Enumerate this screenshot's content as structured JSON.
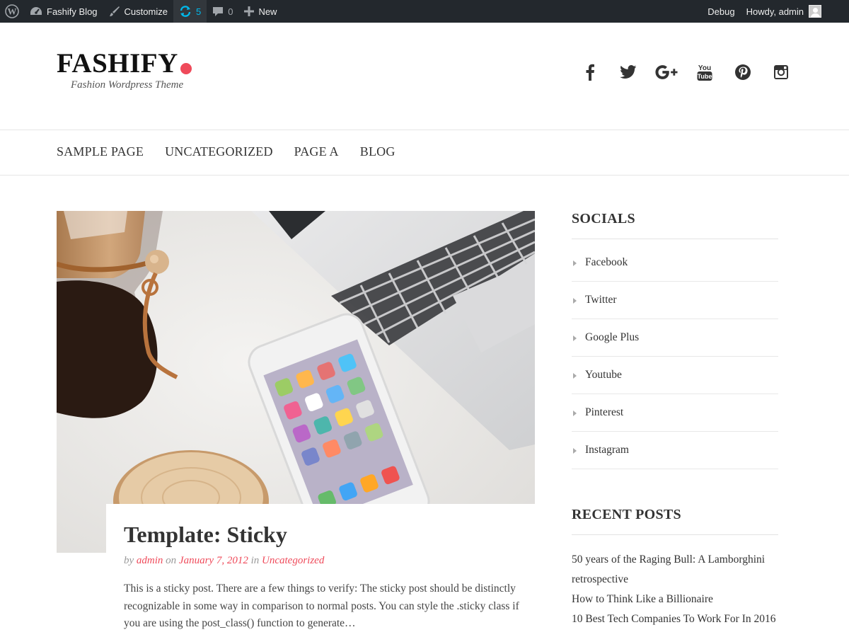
{
  "adminbar": {
    "wp_logo_icon": "wordpress-icon",
    "site_name": "Fashify Blog",
    "customize_label": "Customize",
    "updates_count": "5",
    "comments_count": "0",
    "new_label": "New",
    "debug_label": "Debug",
    "howdy_label": "Howdy, admin",
    "colors": {
      "background": "#23282d",
      "updates_accent": "#00b9eb"
    }
  },
  "header": {
    "site_title": "FASHIFY",
    "tagline": "Fashion Wordpress Theme",
    "accent_color": "#ef4a5a",
    "social_icons": [
      "facebook-icon",
      "twitter-icon",
      "google-plus-icon",
      "youtube-icon",
      "pinterest-icon",
      "instagram-icon"
    ]
  },
  "nav": {
    "items": [
      {
        "label": "SAMPLE PAGE"
      },
      {
        "label": "UNCATEGORIZED"
      },
      {
        "label": "PAGE A"
      },
      {
        "label": "BLOG"
      }
    ]
  },
  "post": {
    "title": "Template: Sticky",
    "meta_by": "by",
    "author": "admin",
    "meta_on": "on",
    "date": "January 7, 2012",
    "meta_in": "in",
    "category": "Uncategorized",
    "excerpt": "This is a sticky post. There are a few things to verify: The sticky post should be distinctly recognizable in some way in comparison to normal posts. You can style the .sticky class if you are using the post_class() function to generate…"
  },
  "sidebar": {
    "socials_title": "SOCIALS",
    "socials": [
      {
        "label": "Facebook"
      },
      {
        "label": "Twitter"
      },
      {
        "label": "Google Plus"
      },
      {
        "label": "Youtube"
      },
      {
        "label": "Pinterest"
      },
      {
        "label": "Instagram"
      }
    ],
    "recent_title": "RECENT POSTS",
    "recent": [
      {
        "label": "50 years of the Raging Bull: A Lamborghini retrospective"
      },
      {
        "label": "How to Think Like a Billionaire"
      },
      {
        "label": "10 Best Tech Companies To Work For In 2016"
      }
    ]
  }
}
